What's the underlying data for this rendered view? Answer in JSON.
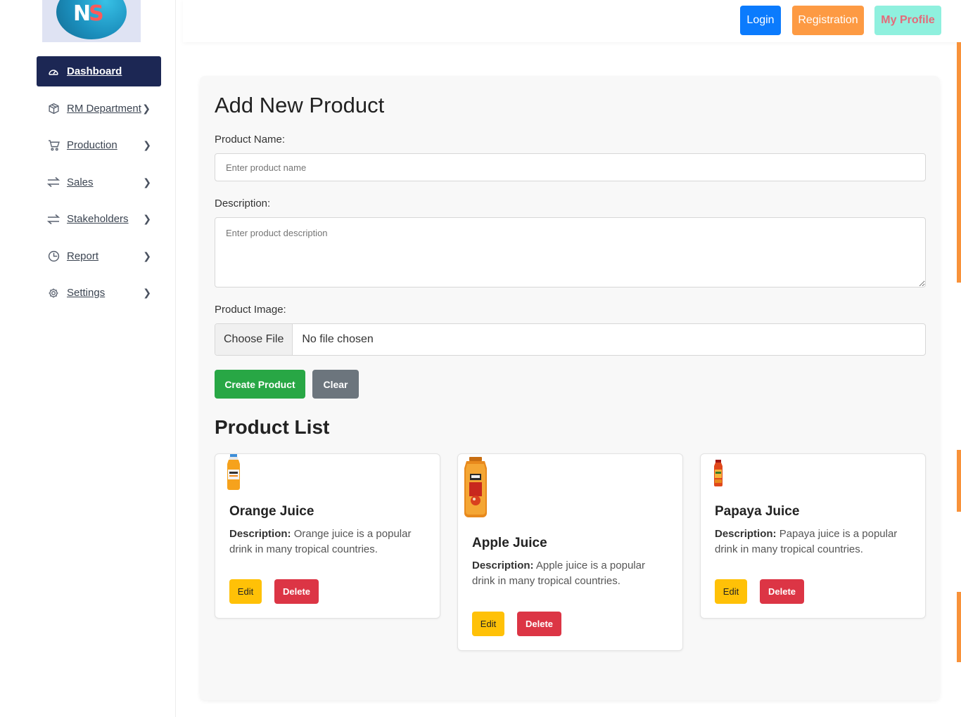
{
  "logo": {
    "letters": [
      "N",
      "S"
    ]
  },
  "sidebar": {
    "items": [
      {
        "label": "Dashboard",
        "icon": "gauge-icon",
        "active": true
      },
      {
        "label": "RM Department",
        "icon": "box-icon"
      },
      {
        "label": "Production",
        "icon": "cart-icon"
      },
      {
        "label": "Sales",
        "icon": "exchange-icon"
      },
      {
        "label": "Stakeholders",
        "icon": "exchange-icon"
      },
      {
        "label": "Report",
        "icon": "clock-icon"
      },
      {
        "label": "Settings",
        "icon": "gear-icon"
      }
    ]
  },
  "header": {
    "login_label": "Login",
    "registration_label": "Registration",
    "profile_label": "My Profile"
  },
  "form": {
    "title": "Add New Product",
    "name_label": "Product Name:",
    "name_placeholder": "Enter product name",
    "description_label": "Description:",
    "description_placeholder": "Enter product description",
    "image_label": "Product Image:",
    "file_button": "Choose File",
    "file_status": "No file chosen",
    "create_label": "Create Product",
    "clear_label": "Clear"
  },
  "list": {
    "title": "Product List",
    "description_prefix": "Description:",
    "edit_label": "Edit",
    "delete_label": "Delete",
    "products": [
      {
        "name": "Orange Juice",
        "description": "Orange juice is a popular drink in many tropical countries."
      },
      {
        "name": "Apple Juice",
        "description": "Apple juice is a popular drink in many tropical countries."
      },
      {
        "name": "Papaya Juice",
        "description": "Papaya juice is a popular drink in many tropical countries."
      }
    ]
  },
  "colors": {
    "sidebar_active": "#1c2754",
    "login": "#0b7bfd",
    "registration": "#fd9a43",
    "profile": "#8ff0de",
    "create": "#28a745",
    "clear": "#6c757d",
    "edit": "#ffc107",
    "delete": "#dc3545"
  }
}
